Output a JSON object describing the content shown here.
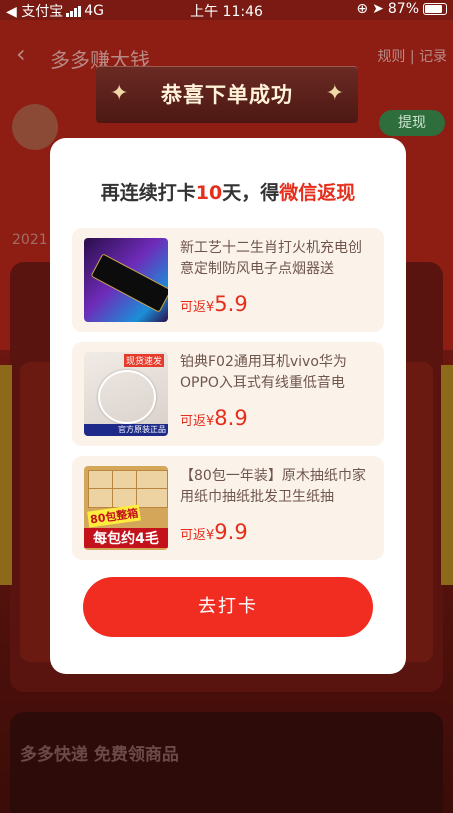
{
  "status_bar": {
    "carrier": "◀ 支付宝",
    "network": "4G",
    "time": "上午 11:46",
    "battery": "87%"
  },
  "nav": {
    "back_icon": "chevron-left-icon",
    "title": "多多赚大钱",
    "links": "规则 | 记录"
  },
  "background": {
    "cash_out": "提现",
    "year": "2021",
    "section_title": "多多快递 免费领商品"
  },
  "banner": {
    "title": "恭喜下单成功"
  },
  "dialog": {
    "headline_pre": "再连续打卡",
    "headline_days": "10",
    "headline_mid": "天，得",
    "headline_red": "微信返现",
    "items": [
      {
        "name": "新工艺十二生肖打火机充电创意定制防风电子点烟器送",
        "price_label": "可返¥",
        "price": "5.9"
      },
      {
        "name": "铂典F02通用耳机vivo华为OPPO入耳式有线重低音电",
        "price_label": "可返¥",
        "price": "8.9",
        "thumb_tag": "现货速发",
        "thumb_bar": "官方原装正品"
      },
      {
        "name": "【80包一年装】原木抽纸巾家用纸巾抽纸批发卫生纸抽",
        "price_label": "可返¥",
        "price": "9.9",
        "thumb_label1": "80包整箱",
        "thumb_label2": "每包约4毛"
      }
    ],
    "cta": "去打卡"
  },
  "colors": {
    "accent_red": "#e62e1c",
    "button_red": "#f12d22",
    "item_bg": "#fbf3ea"
  }
}
